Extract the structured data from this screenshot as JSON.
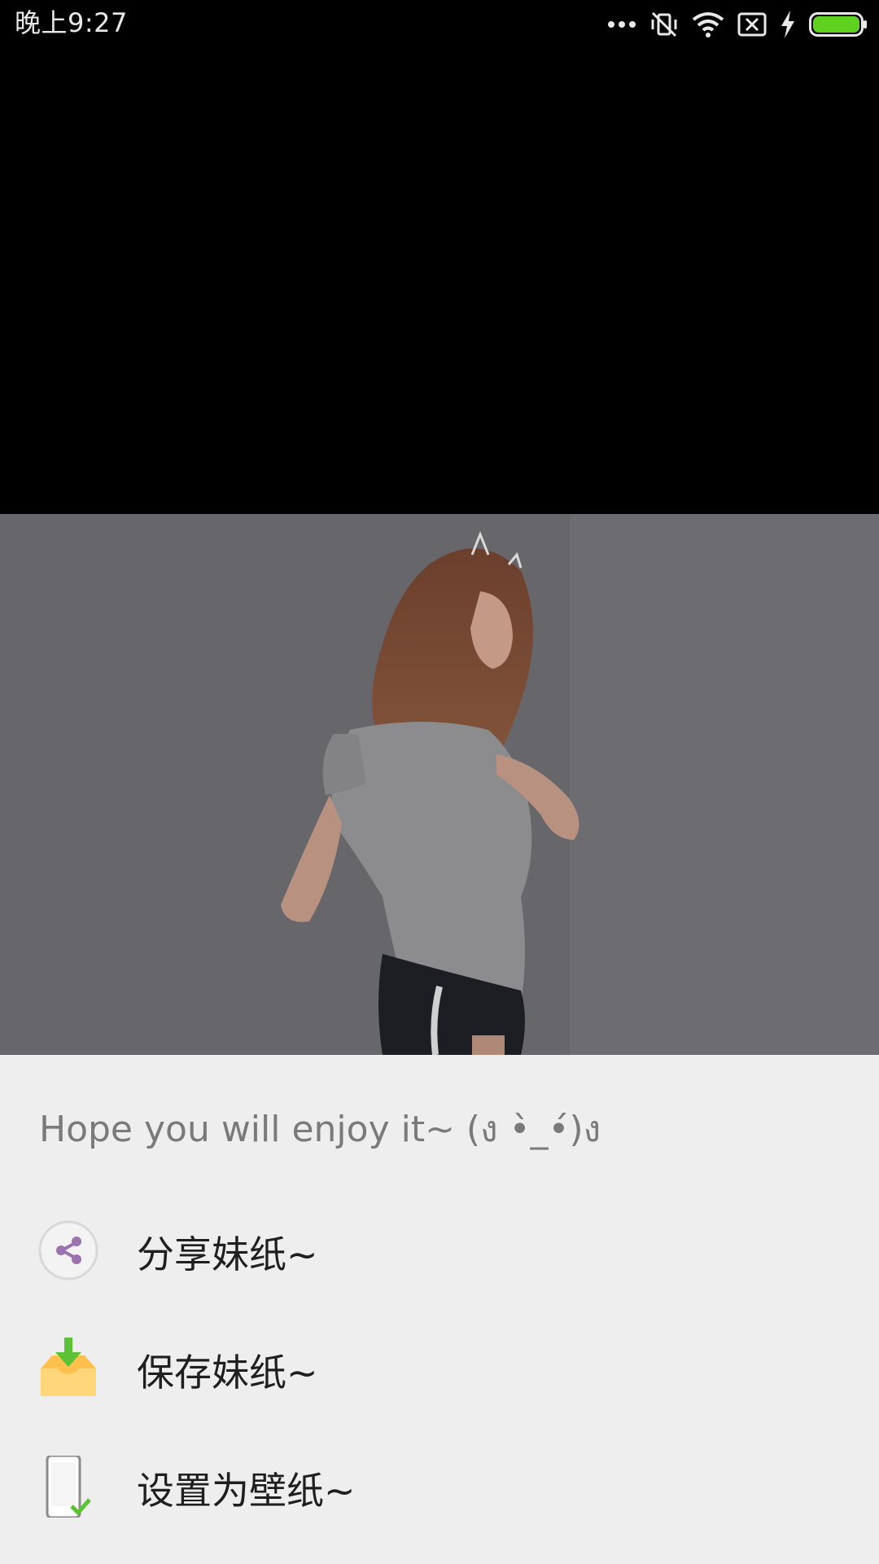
{
  "status_bar": {
    "time": "晚上9:27",
    "icons": [
      "more-icon",
      "vibrate-off-icon",
      "wifi-icon",
      "sim-off-icon",
      "charging-icon",
      "battery-icon"
    ],
    "battery_color": "#5fd21f"
  },
  "photo": {
    "description_icon": "photo-image"
  },
  "sheet": {
    "title": "Hope you will enjoy it~ (ง •̀_•́)ง",
    "items": [
      {
        "label": "分享妹纸~",
        "icon": "share-icon"
      },
      {
        "label": "保存妹纸~",
        "icon": "save-tray-icon"
      },
      {
        "label": "设置为壁纸~",
        "icon": "phone-wallpaper-icon"
      }
    ]
  },
  "colors": {
    "sheet_bg": "#eeeeee",
    "title_text": "#7a7a7a",
    "item_text": "#1f1f1f",
    "save_icon_orange": "#ffc04d",
    "save_icon_green": "#5bc236",
    "share_icon_purple": "#9b74b0"
  }
}
